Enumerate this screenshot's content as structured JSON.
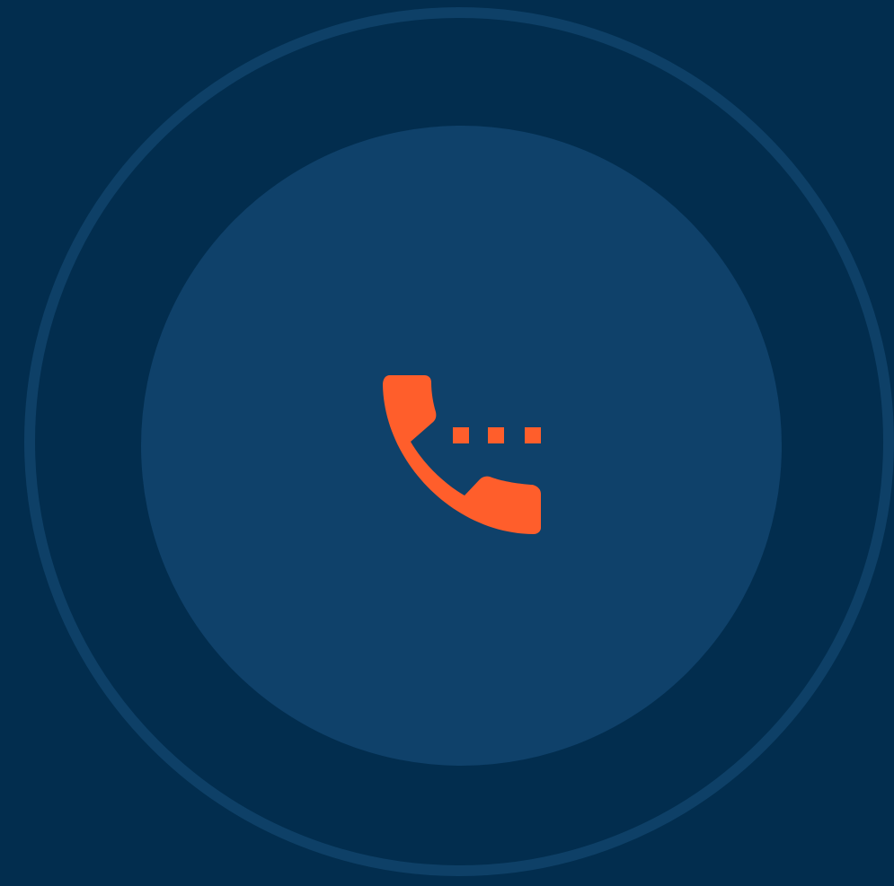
{
  "icon": {
    "name": "phone-calling-icon",
    "color": "#ff5e2b"
  },
  "colors": {
    "background": "#022d4e",
    "ring": "#0e4067",
    "disc": "#0f416a"
  }
}
